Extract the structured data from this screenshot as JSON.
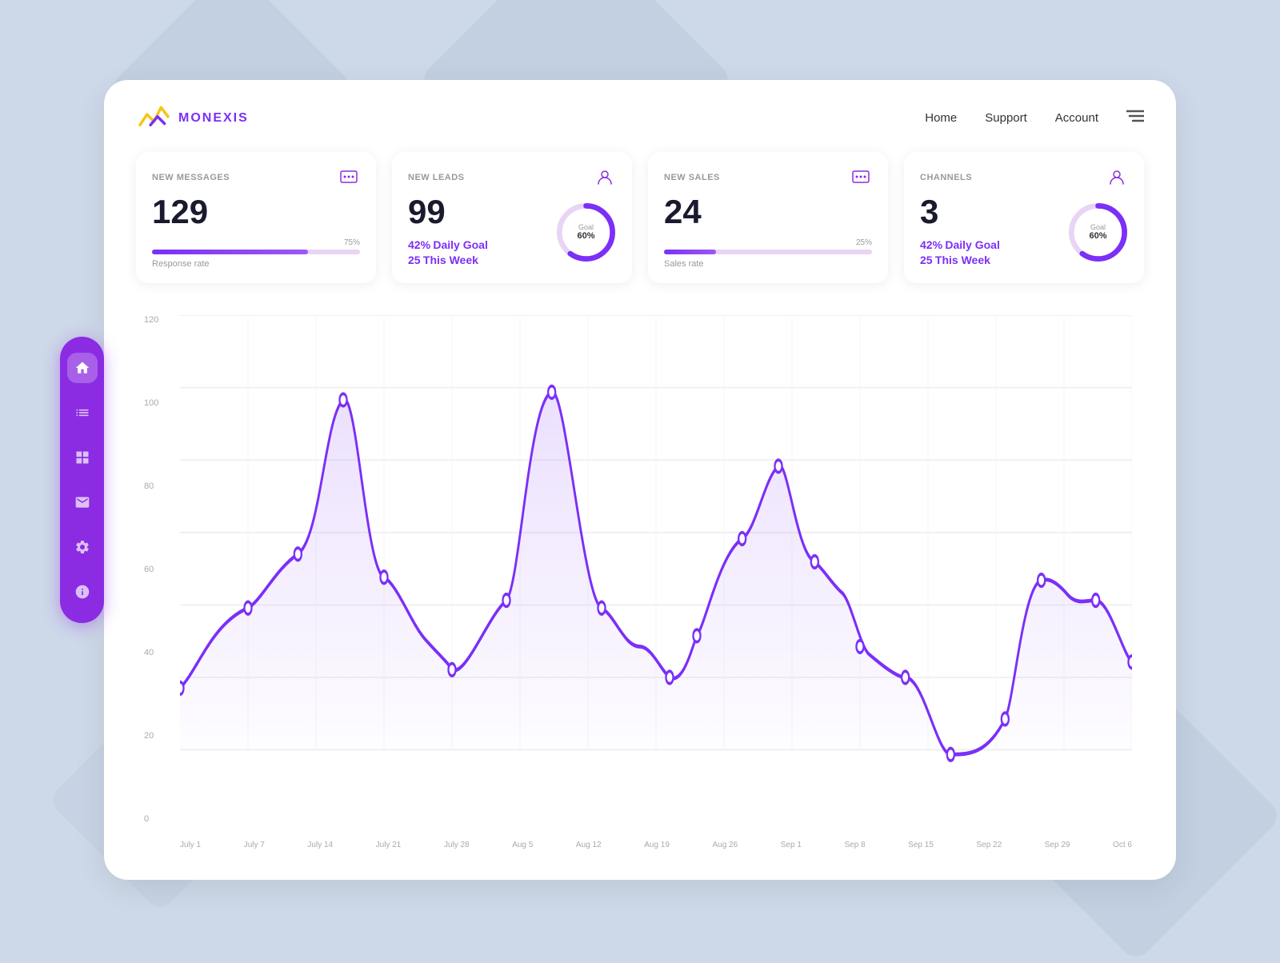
{
  "app": {
    "name": "MONEXIS"
  },
  "nav": {
    "home": "Home",
    "support": "Support",
    "account": "Account"
  },
  "stats": [
    {
      "id": "messages",
      "label": "NEW MESSAGES",
      "value": "129",
      "bar_pct": 75,
      "bar_label": "75%",
      "sub_label": "Response rate",
      "has_chart": false,
      "icon": "chat"
    },
    {
      "id": "leads",
      "label": "NEW LEADS",
      "value": "99",
      "has_chart": true,
      "goal_pct": "42%",
      "goal_label": "Daily Goal",
      "week_value": "25",
      "week_label": "This Week",
      "chart_pct": 60,
      "icon": "user"
    },
    {
      "id": "sales",
      "label": "NEW SALES",
      "value": "24",
      "bar_pct": 25,
      "bar_label": "25%",
      "sub_label": "Sales rate",
      "has_chart": false,
      "icon": "chat"
    },
    {
      "id": "channels",
      "label": "CHANNELS",
      "value": "3",
      "has_chart": true,
      "goal_pct": "42%",
      "goal_label": "Daily Goal",
      "week_value": "25",
      "week_label": "This Week",
      "chart_pct": 60,
      "icon": "user"
    }
  ],
  "chart": {
    "y_labels": [
      "120",
      "100",
      "80",
      "60",
      "40",
      "20",
      "0"
    ],
    "x_labels": [
      "July 1",
      "July 7",
      "July 14",
      "July 21",
      "July 28",
      "Aug 5",
      "Aug 12",
      "Aug 19",
      "Aug 26",
      "Sep 1",
      "Sep 8",
      "Sep 15",
      "Sep 22",
      "Sep 29",
      "Oct 6"
    ],
    "color": "#7b2ff7"
  },
  "sidebar": {
    "items": [
      {
        "id": "home",
        "icon": "home",
        "active": true
      },
      {
        "id": "list",
        "icon": "list",
        "active": false
      },
      {
        "id": "grid",
        "icon": "grid",
        "active": false
      },
      {
        "id": "mail",
        "icon": "mail",
        "active": false
      },
      {
        "id": "settings",
        "icon": "settings",
        "active": false
      },
      {
        "id": "info",
        "icon": "info",
        "active": false
      }
    ]
  }
}
